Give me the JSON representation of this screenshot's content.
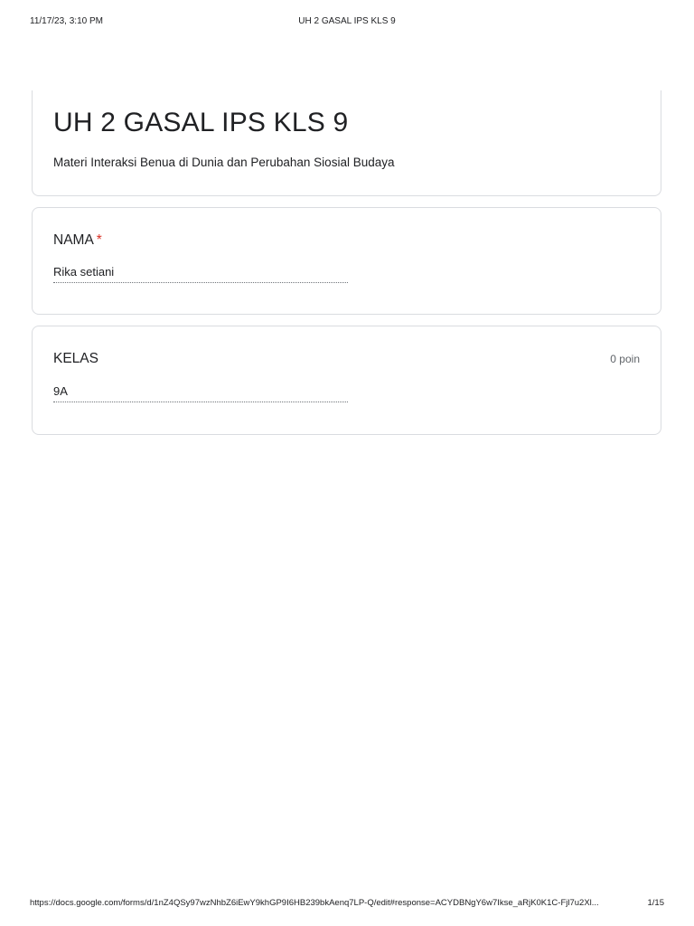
{
  "print_header": {
    "datetime": "11/17/23, 3:10 PM",
    "title": "UH 2 GASAL IPS KLS 9"
  },
  "form": {
    "title": "UH 2 GASAL IPS KLS 9",
    "description": "Materi Interaksi Benua di Dunia dan Perubahan Siosial Budaya"
  },
  "questions": [
    {
      "label": "NAMA",
      "required_marker": "*",
      "answer": "Rika setiani"
    },
    {
      "label": "KELAS",
      "points": "0 poin",
      "answer": "9A"
    }
  ],
  "print_footer": {
    "url": "https://docs.google.com/forms/d/1nZ4QSy97wzNhbZ6iEwY9khGP9I6HB239bkAenq7LP-Q/edit#response=ACYDBNgY6w7Ikse_aRjK0K1C-Fjl7u2Xl...",
    "page": "1/15"
  },
  "colors": {
    "required": "#d93025",
    "border": "#dadce0",
    "muted_text": "#5f6368"
  }
}
